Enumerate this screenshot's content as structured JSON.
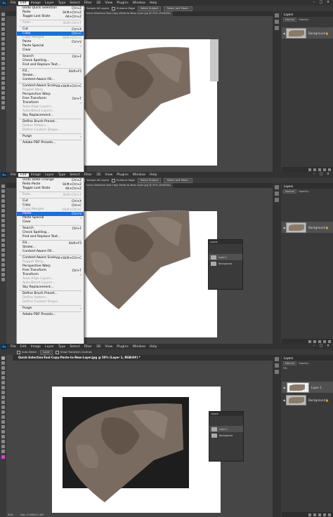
{
  "menubar": {
    "logo": "Ps",
    "items": [
      "File",
      "Edit",
      "Image",
      "Layer",
      "Type",
      "Select",
      "Filter",
      "3D",
      "View",
      "Plugins",
      "Window",
      "Help"
    ]
  },
  "optbar": {
    "sample_all_layers": "Sample All Layers",
    "enhance_edge": "Enhance Edge",
    "select_subject": "Select Subject",
    "select_and_mask": "Select and Mask..."
  },
  "optbar3": {
    "auto_select": "Auto-Select:",
    "layer": "Layer",
    "show_transform": "Show Transform Controls"
  },
  "edit_menu": [
    {
      "label": "Undo Quick Selection",
      "shortcut": "Ctrl+Z"
    },
    {
      "label": "Redo",
      "shortcut": "Shift+Ctrl+Z"
    },
    {
      "label": "Toggle Last State",
      "shortcut": "Alt+Ctrl+Z"
    },
    {
      "sep": true
    },
    {
      "label": "Fade...",
      "shortcut": "Shift+Ctrl+F",
      "disabled": true
    },
    {
      "sep": true
    },
    {
      "label": "Cut",
      "shortcut": "Ctrl+X"
    },
    {
      "label": "Copy",
      "shortcut": "Ctrl+C"
    },
    {
      "label": "Copy Merged",
      "shortcut": "Shift+Ctrl+C",
      "disabled": true
    },
    {
      "label": "Paste",
      "shortcut": "Ctrl+V"
    },
    {
      "label": "Paste Special",
      "shortcut": "›"
    },
    {
      "label": "Clear",
      "shortcut": ""
    },
    {
      "sep": true
    },
    {
      "label": "Search",
      "shortcut": "Ctrl+F"
    },
    {
      "label": "Check Spelling...",
      "shortcut": ""
    },
    {
      "label": "Find and Replace Text...",
      "shortcut": ""
    },
    {
      "sep": true
    },
    {
      "label": "Fill...",
      "shortcut": "Shift+F5"
    },
    {
      "label": "Stroke...",
      "shortcut": ""
    },
    {
      "label": "Content-Aware Fill...",
      "shortcut": ""
    },
    {
      "sep": true
    },
    {
      "label": "Content-Aware Scale",
      "shortcut": "Alt+Shift+Ctrl+C"
    },
    {
      "label": "Puppet Warp",
      "shortcut": "",
      "disabled": true
    },
    {
      "label": "Perspective Warp",
      "shortcut": ""
    },
    {
      "label": "Free Transform",
      "shortcut": "Ctrl+T"
    },
    {
      "label": "Transform",
      "shortcut": "›"
    },
    {
      "label": "Auto-Align Layers...",
      "shortcut": "",
      "disabled": true
    },
    {
      "label": "Auto-Blend Layers...",
      "shortcut": "",
      "disabled": true
    },
    {
      "label": "Sky Replacement...",
      "shortcut": ""
    },
    {
      "sep": true
    },
    {
      "label": "Define Brush Preset...",
      "shortcut": ""
    },
    {
      "label": "Define Pattern...",
      "shortcut": "",
      "disabled": true
    },
    {
      "label": "Define Custom Shape...",
      "shortcut": "",
      "disabled": true
    },
    {
      "sep": true
    },
    {
      "label": "Purge",
      "shortcut": "›"
    },
    {
      "sep": true
    },
    {
      "label": "Adobe PDF Presets...",
      "shortcut": ""
    }
  ],
  "edit_menu2": [
    {
      "label": "Undo State Change",
      "shortcut": "Ctrl+Z"
    },
    {
      "label": "Redo Paste",
      "shortcut": "Shift+Ctrl+Z"
    },
    {
      "label": "Toggle Last State",
      "shortcut": "Alt+Ctrl+Z"
    },
    {
      "sep": true
    },
    {
      "label": "Fade...",
      "shortcut": "Shift+Ctrl+F",
      "disabled": true
    },
    {
      "sep": true
    },
    {
      "label": "Cut",
      "shortcut": "Ctrl+X"
    },
    {
      "label": "Copy",
      "shortcut": "Ctrl+C"
    },
    {
      "label": "Copy Merged",
      "shortcut": "Shift+Ctrl+C",
      "disabled": true
    },
    {
      "label": "Paste",
      "shortcut": "Ctrl+V"
    },
    {
      "label": "Paste Special",
      "shortcut": "›"
    },
    {
      "label": "Clear",
      "shortcut": ""
    },
    {
      "sep": true
    },
    {
      "label": "Search",
      "shortcut": "Ctrl+F"
    },
    {
      "label": "Check Spelling...",
      "shortcut": ""
    },
    {
      "label": "Find and Replace Text...",
      "shortcut": ""
    },
    {
      "sep": true
    },
    {
      "label": "Fill...",
      "shortcut": "Shift+F5"
    },
    {
      "label": "Stroke...",
      "shortcut": ""
    },
    {
      "label": "Content-Aware Fill...",
      "shortcut": ""
    },
    {
      "sep": true
    },
    {
      "label": "Content-Aware Scale",
      "shortcut": "Alt+Shift+Ctrl+C"
    },
    {
      "label": "Puppet Warp",
      "shortcut": "",
      "disabled": true
    },
    {
      "label": "Perspective Warp",
      "shortcut": ""
    },
    {
      "label": "Free Transform",
      "shortcut": "Ctrl+T"
    },
    {
      "label": "Transform",
      "shortcut": "›"
    },
    {
      "label": "Auto-Align Layers...",
      "shortcut": "",
      "disabled": true
    },
    {
      "label": "Auto-Blend Layers...",
      "shortcut": "",
      "disabled": true
    },
    {
      "label": "Sky Replacement...",
      "shortcut": ""
    },
    {
      "sep": true
    },
    {
      "label": "Define Brush Preset...",
      "shortcut": ""
    },
    {
      "label": "Define Pattern...",
      "shortcut": "",
      "disabled": true
    },
    {
      "label": "Define Custom Shape...",
      "shortcut": "",
      "disabled": true
    },
    {
      "sep": true
    },
    {
      "label": "Purge",
      "shortcut": "›"
    },
    {
      "sep": true
    },
    {
      "label": "Adobe PDF Presets...",
      "shortcut": ""
    }
  ],
  "layers": {
    "tab": "Layers",
    "background": "Background",
    "layer1": "Layer 1",
    "normal": "Normal",
    "opacity": "Opacity:",
    "fill": "Fill:"
  },
  "doc": {
    "tab1": "Quick-Selection-Tool-Copy-Paste-to-New-Layer.jpg @ 50% (RGB/8#)",
    "title3": "Quick-Selection-Tool-Copy-Paste-to-New-Layer.jpg @ 50% (Layer 1, RGB/8#) *",
    "zoom": "50%",
    "docsize": "Doc: 5.93M/11.4M"
  },
  "colors": {
    "highlight": "#1f6fd6",
    "ps_blue": "#31a8ff"
  }
}
